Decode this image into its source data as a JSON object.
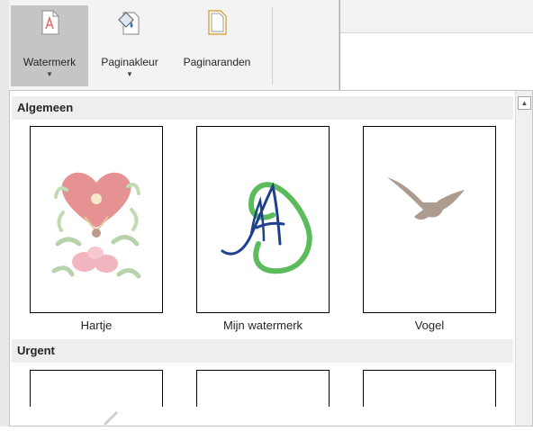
{
  "ribbon": {
    "buttons": [
      {
        "label": "Watermerk",
        "has_dropdown": true,
        "active": true,
        "icon": "watermark-icon"
      },
      {
        "label": "Paginakleur",
        "has_dropdown": true,
        "active": false,
        "icon": "page-color-icon"
      },
      {
        "label": "Paginaranden",
        "has_dropdown": false,
        "active": false,
        "icon": "page-borders-icon"
      }
    ]
  },
  "gallery": {
    "sections": [
      {
        "title": "Algemeen",
        "items": [
          {
            "caption": "Hartje",
            "icon": "heart-watermark"
          },
          {
            "caption": "Mijn watermerk",
            "icon": "monogram-a-watermark"
          },
          {
            "caption": "Vogel",
            "icon": "bird-watermark"
          }
        ]
      },
      {
        "title": "Urgent",
        "items": [
          {
            "caption": "",
            "icon": "urgent-watermark-1"
          },
          {
            "caption": "",
            "icon": "urgent-watermark-2"
          },
          {
            "caption": "",
            "icon": "urgent-watermark-3"
          }
        ]
      }
    ]
  },
  "colors": {
    "accent": "#4472c4",
    "active_button": "#c5c5c5",
    "section_header": "#eeeeee"
  }
}
